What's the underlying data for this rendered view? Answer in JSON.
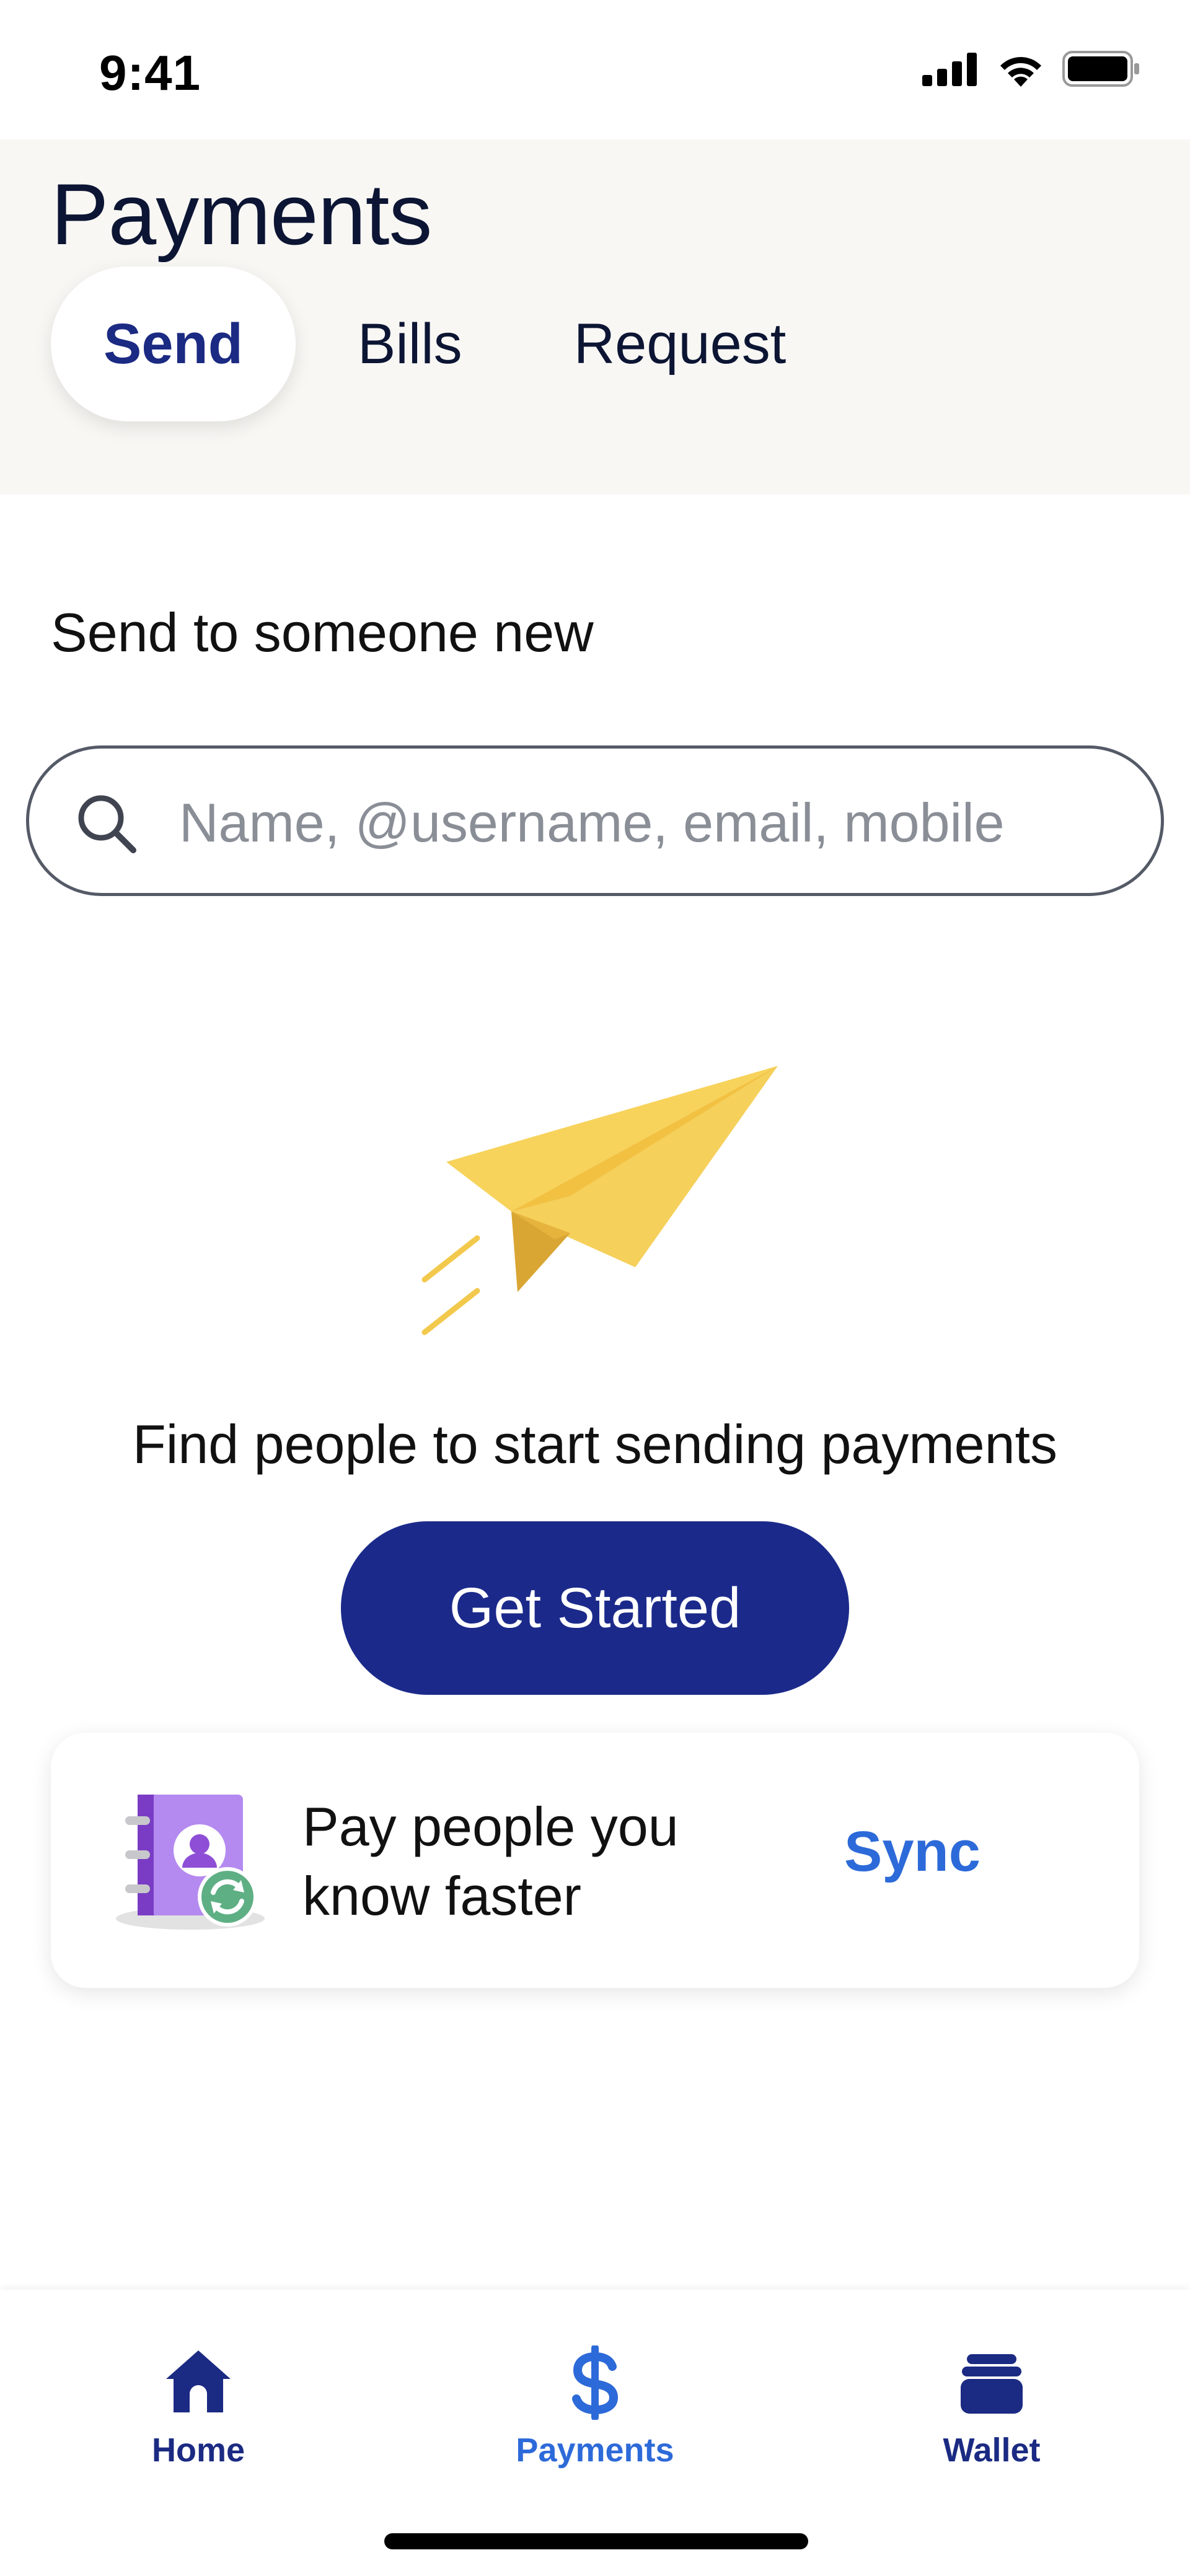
{
  "status_bar": {
    "time": "9:41"
  },
  "header": {
    "title": "Payments",
    "tabs": [
      {
        "label": "Send",
        "active": true
      },
      {
        "label": "Bills",
        "active": false
      },
      {
        "label": "Request",
        "active": false
      }
    ]
  },
  "send": {
    "section_label": "Send to someone new",
    "search": {
      "placeholder": "Name, @username, email, mobile",
      "value": ""
    },
    "empty_message": "Find people to start sending payments",
    "cta_label": "Get Started"
  },
  "sync_card": {
    "line1": "Pay people you",
    "line2": "know faster",
    "action_label": "Sync"
  },
  "bottom_nav": {
    "items": [
      {
        "label": "Home",
        "icon": "home-icon"
      },
      {
        "label": "Payments",
        "icon": "dollar-icon",
        "active": true
      },
      {
        "label": "Wallet",
        "icon": "wallet-icon"
      }
    ]
  },
  "colors": {
    "brand_navy": "#1b2a8a",
    "link_blue": "#2d6ad9",
    "header_bg": "#f8f7f4",
    "plane_yellow": "#f7d35c"
  }
}
